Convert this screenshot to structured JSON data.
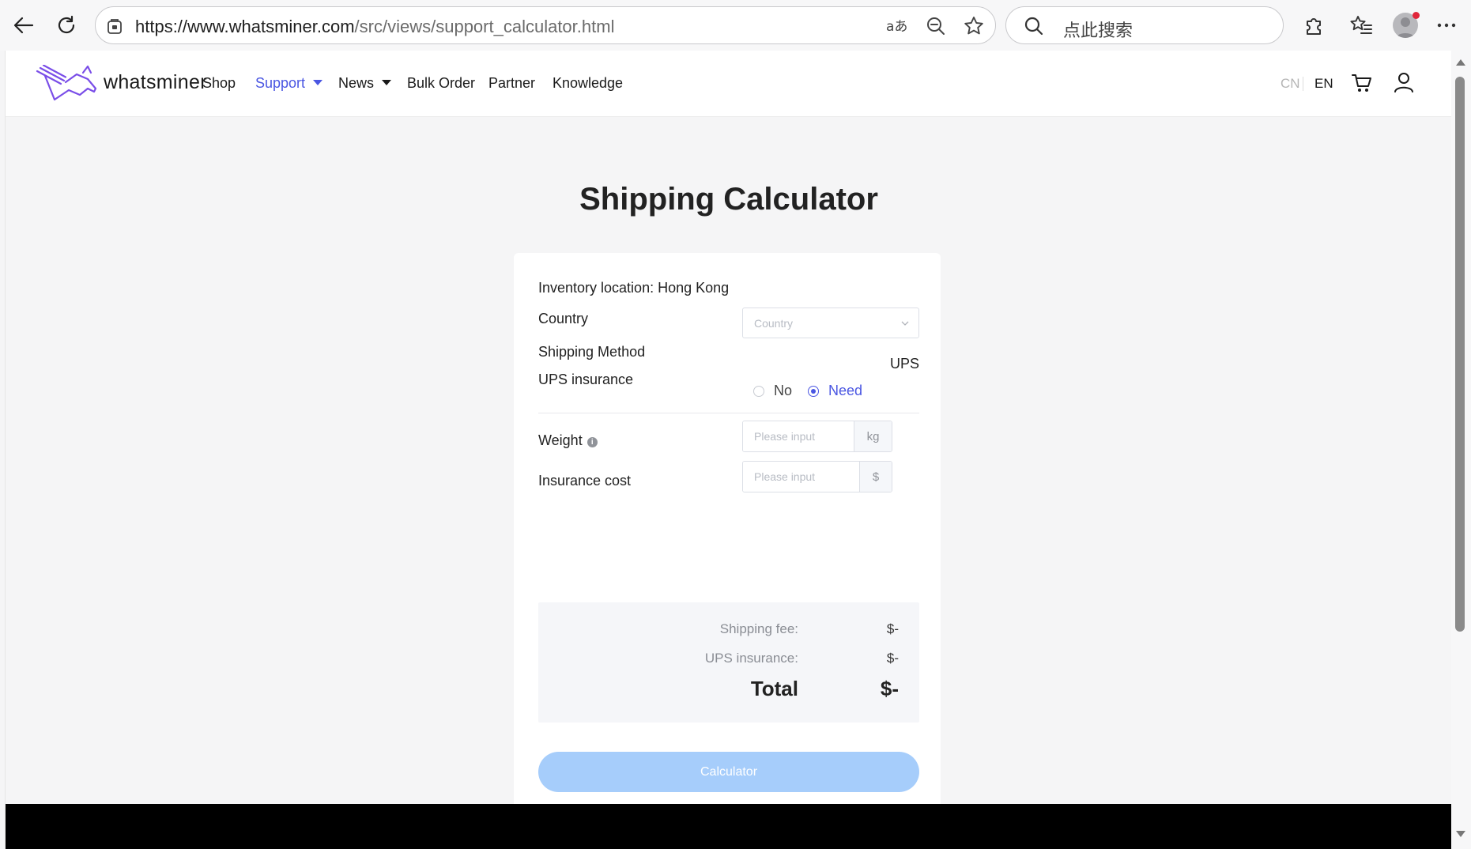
{
  "browser": {
    "url_host": "https://www.whatsminer.com",
    "url_path": "/src/views/support_calculator.html",
    "search_placeholder": "点此搜索"
  },
  "site": {
    "logo_text": "whatsminer",
    "nav": [
      {
        "label": "Shop"
      },
      {
        "label": "Support",
        "active": true,
        "dropdown": true
      },
      {
        "label": "News",
        "dropdown": true
      },
      {
        "label": "Bulk Order"
      },
      {
        "label": "Partner"
      },
      {
        "label": "Knowledge"
      }
    ],
    "lang_cn": "CN",
    "lang_en": "EN",
    "accent_color": "#4a56e2"
  },
  "calculator": {
    "title": "Shipping Calculator",
    "inventory_location": "Inventory location: Hong Kong",
    "country_label": "Country",
    "country_placeholder": "Country",
    "shipping_method_label": "Shipping Method",
    "shipping_method_value": "UPS",
    "insurance_label": "UPS insurance",
    "insurance_options": [
      "No",
      "Need"
    ],
    "insurance_selected": "Need",
    "weight_label": "Weight",
    "weight_placeholder": "Please input",
    "weight_unit": "kg",
    "insurance_cost_label": "Insurance cost",
    "insurance_cost_placeholder": "Please input",
    "insurance_cost_unit": "$",
    "shipping_fee_label": "Shipping fee:",
    "shipping_fee_value": "$-",
    "ups_insurance_label": "UPS insurance:",
    "ups_insurance_value": "$-",
    "total_label": "Total",
    "total_value": "$-",
    "button_label": "Calculator",
    "button_color": "#a6cdfb"
  }
}
